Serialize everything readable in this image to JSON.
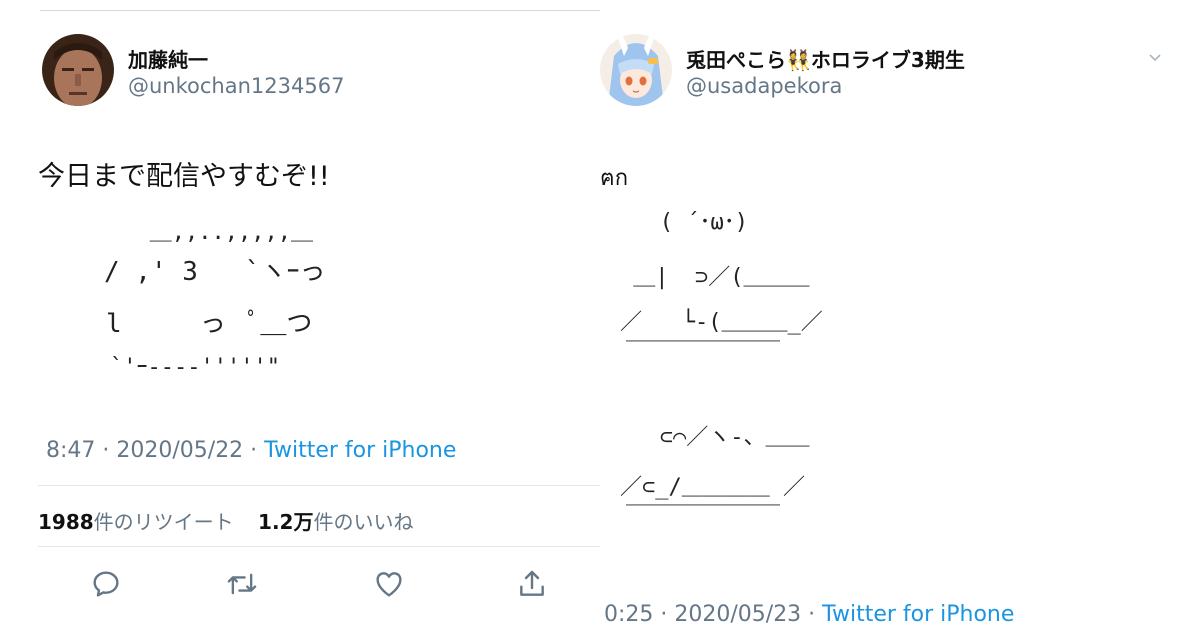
{
  "left_tweet": {
    "author": {
      "name": "加藤純一",
      "handle": "@unkochan1234567"
    },
    "text": "今日まで配信やすむぞ!!",
    "ascii_art": [
      "   ＿,,..,,,,,＿",
      "/ ,' 3   `ヽｰっ",
      "l     っ  ﾟ＿つ",
      "`'ｰ---‐'''''\""
    ],
    "meta": {
      "time_date": "8:47 · 2020/05/22 · ",
      "source": "Twitter for iPhone"
    },
    "stats": {
      "retweets": "1988",
      "retweets_label": "件のリツイート",
      "likes": "1.2万",
      "likes_label": "件のいいね"
    }
  },
  "right_tweet": {
    "author": {
      "name": "兎田ぺこら👯ホロライブ3期生",
      "handle": "@usadapekora"
    },
    "text_fragment": "ฅก",
    "ascii_art": [
      "   ( ´･ω･)",
      " ＿|  ⊃／(＿＿＿",
      "／   └-(＿＿＿_／",
      "￣￣￣￣￣￣￣",
      "",
      "   ⊂⌒／ヽ-、＿＿",
      "／⊂_/＿＿＿＿ ／",
      "￣￣￣￣￣￣￣"
    ],
    "meta": {
      "time_date": "0:25 · 2020/05/23 · ",
      "source": "Twitter for iPhone"
    }
  },
  "colors": {
    "link": "#1b95e0",
    "secondary_text": "#657786",
    "primary_text": "#111111"
  }
}
